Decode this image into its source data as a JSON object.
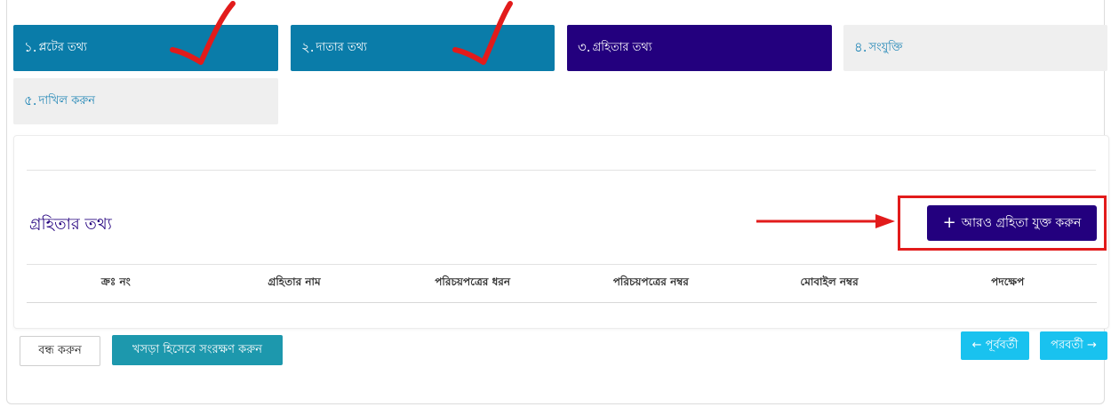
{
  "steps": [
    {
      "num": "১.",
      "label": "প্লটের তথ্য",
      "state": "done"
    },
    {
      "num": "২.",
      "label": "দাতার তথ্য",
      "state": "done"
    },
    {
      "num": "৩.",
      "label": "গ্রহিতার তথ্য",
      "state": "active"
    },
    {
      "num": "৪.",
      "label": "সংযুক্তি",
      "state": "pending"
    },
    {
      "num": "৫.",
      "label": "দাখিল করুন",
      "state": "pending"
    }
  ],
  "section": {
    "title": "গ্রহিতার তথ্য",
    "add_button": "আরও গ্রহিতা যুক্ত করুন"
  },
  "table": {
    "headers": [
      "ক্রঃ নং",
      "গ্রহিতার নাম",
      "পরিচয়পত্রের ধরন",
      "পরিচয়পত্রের নম্বর",
      "মোবাইল নম্বর",
      "পদক্ষেপ"
    ]
  },
  "footer": {
    "close": "বন্ধ করুন",
    "save_draft": "খসড়া হিসেবে সংরক্ষণ করুন",
    "prev": "← পূর্ববর্তী",
    "next": "পরবর্তী →"
  },
  "colors": {
    "step_done": "#0a7ca9",
    "step_active": "#23007e",
    "step_pending": "#efefef",
    "annotation_red": "#e21b1b",
    "nav_button": "#19c2ef",
    "draft_button": "#1d98ad"
  },
  "icons": [
    "plus-icon",
    "check-mark-icon",
    "arrow-right-icon"
  ]
}
